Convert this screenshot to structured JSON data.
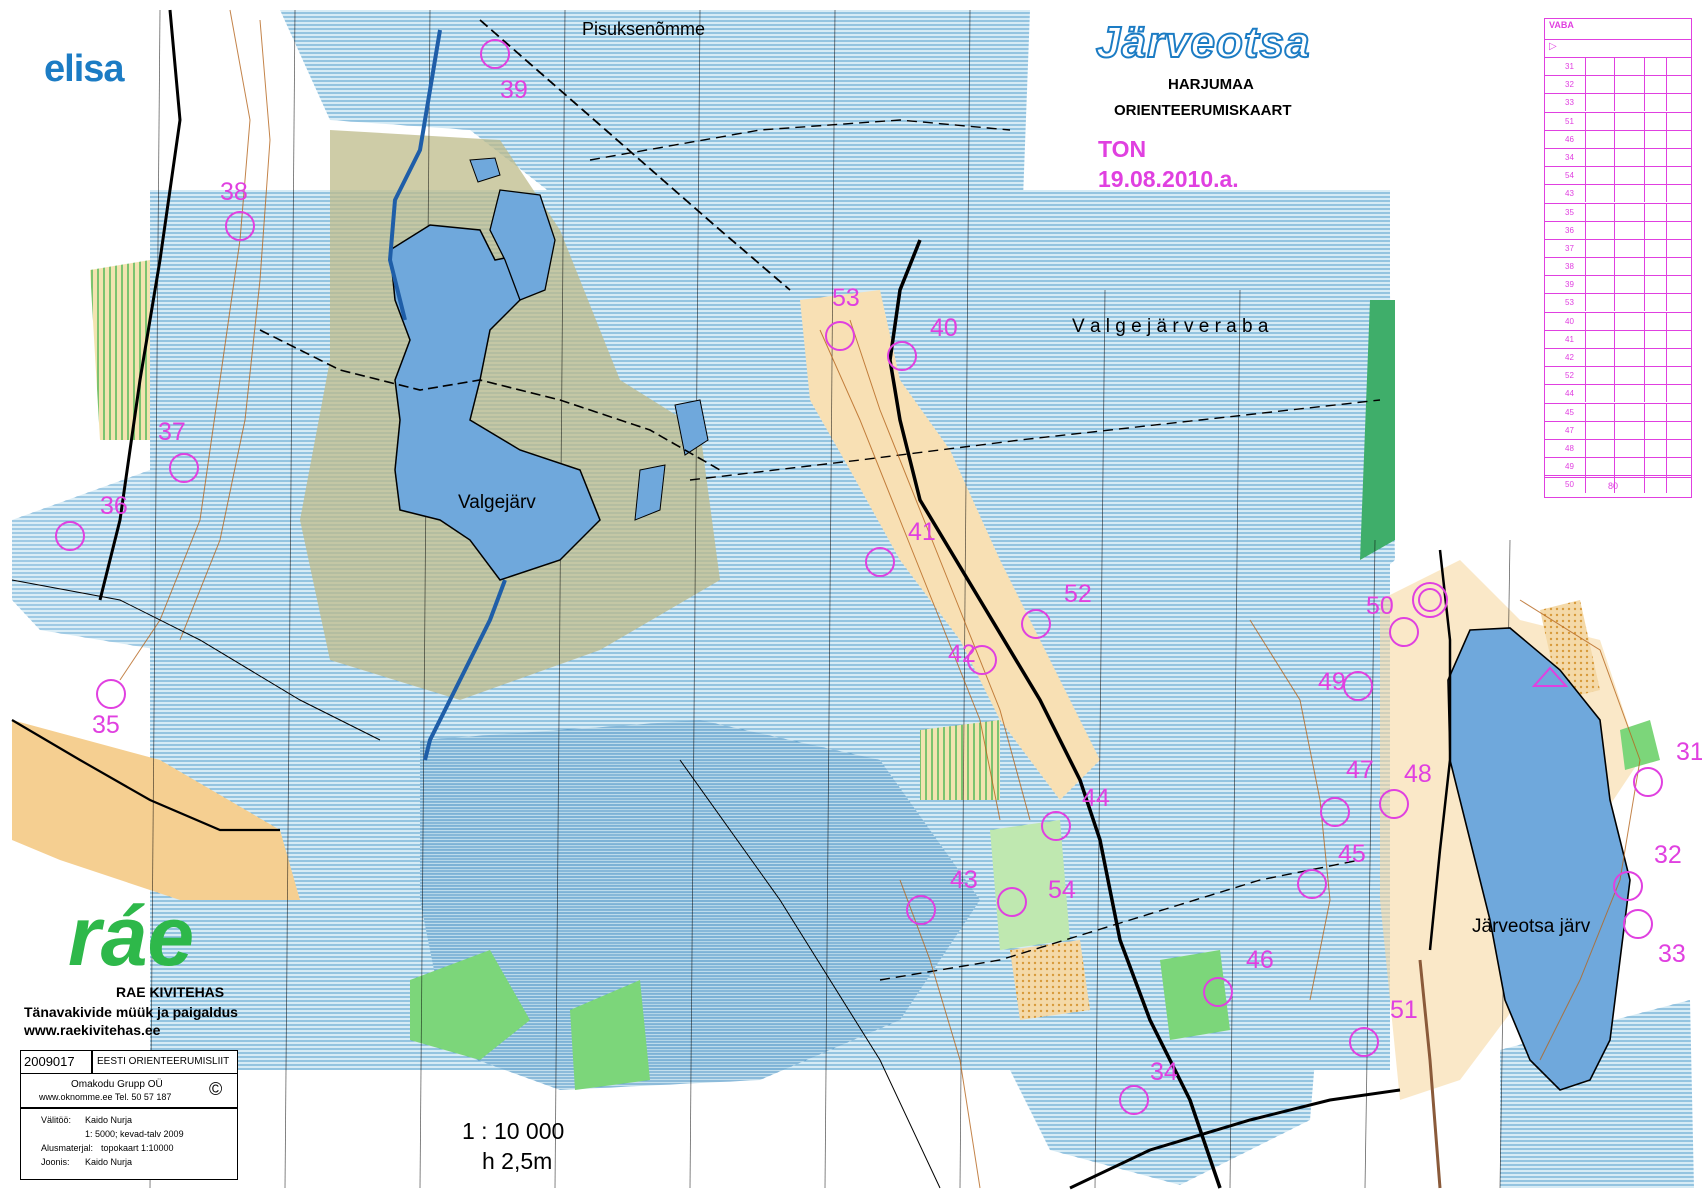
{
  "map": {
    "title": "Järveotsa",
    "region": "HARJUMAA",
    "subtitle": "ORIENTEERUMISKAART",
    "event": "TON",
    "date": "19.08.2010.a.",
    "scale": "1 : 10 000",
    "contour": "h 2,5m",
    "place_names": {
      "pisuksenomme": "Pisuksenõmme",
      "valgejarv": "Valgejärv",
      "valgejarve_raba": "V a l g e j ä r v e   r a b a",
      "jarveotsa_jarv": "Järveotsa järv"
    }
  },
  "sponsors": {
    "elisa": "elisa",
    "rae_logo": "ráe",
    "rae_name": "RAE KIVITEHAS",
    "rae_tagline": "Tänavakivide müük ja paigaldus",
    "rae_url": "www.raekivitehas.ee"
  },
  "info_box": {
    "code": "2009017",
    "federation": "EESTI ORIENTEERUMISLIIT",
    "publisher": "Omakodu Grupp OÜ",
    "publisher_contact": "www.oknomme.ee  Tel. 50 57 187",
    "copyright": "©",
    "survey_label": "Välitöö:",
    "survey_value": "Kaido Nurja",
    "survey_detail": "1: 5000; kevad-talv 2009",
    "base_label": "Alusmaterjal:",
    "base_value": "topokaart  1:10000",
    "drawn_label": "Joonis:",
    "drawn_value": "Kaido Nurja"
  },
  "description_sheet": {
    "header": "VABA",
    "controls": [
      "31",
      "32",
      "33",
      "51",
      "46",
      "34",
      "54",
      "43",
      "35",
      "36",
      "37",
      "38",
      "39",
      "53",
      "40",
      "41",
      "42",
      "52",
      "44",
      "45",
      "47",
      "48",
      "49",
      "50"
    ],
    "finish_distance": "80"
  },
  "controls": [
    {
      "label": "31"
    },
    {
      "label": "32"
    },
    {
      "label": "33"
    },
    {
      "label": "34"
    },
    {
      "label": "35"
    },
    {
      "label": "36"
    },
    {
      "label": "37"
    },
    {
      "label": "38"
    },
    {
      "label": "39"
    },
    {
      "label": "40"
    },
    {
      "label": "41"
    },
    {
      "label": "42"
    },
    {
      "label": "43"
    },
    {
      "label": "44"
    },
    {
      "label": "45"
    },
    {
      "label": "46"
    },
    {
      "label": "47"
    },
    {
      "label": "48"
    },
    {
      "label": "49"
    },
    {
      "label": "50"
    },
    {
      "label": "51"
    },
    {
      "label": "52"
    },
    {
      "label": "53"
    },
    {
      "label": "54"
    }
  ],
  "colors": {
    "course": "#e040e0",
    "water": "#6fa8dc",
    "marsh_blue": "#a8cfe3",
    "open_land": "#f5c98a",
    "green": "#7cd67a",
    "dark_green": "#3fae6a",
    "olive": "#b9b78a",
    "contour": "#b5651d",
    "logo_blue": "#1c7cc4"
  },
  "icons": {
    "start": "start-triangle-icon",
    "finish": "finish-double-circle-icon"
  }
}
